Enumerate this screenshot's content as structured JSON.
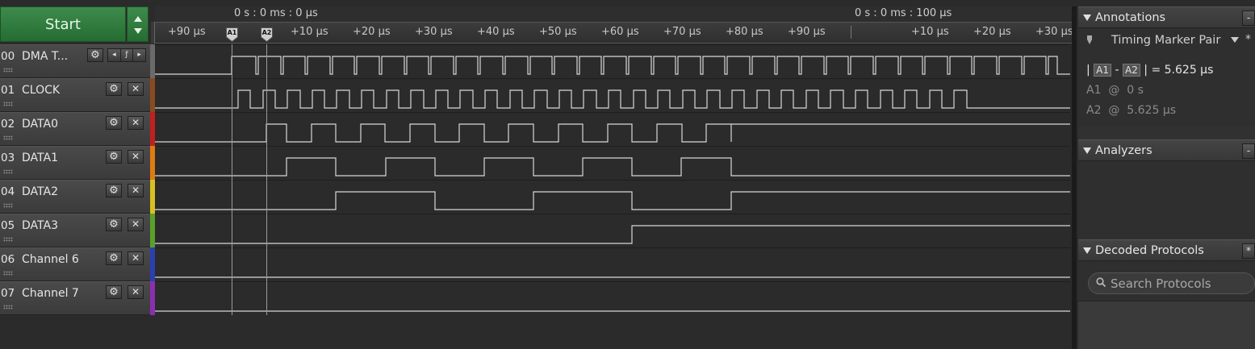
{
  "toolbar": {
    "start_label": "Start"
  },
  "timeline": {
    "absolute_times": [
      "0 s : 0 ms : 0 μs",
      "0 s : 0 ms : 100 μs"
    ],
    "ticks": [
      "+90 μs",
      "+10 μs",
      "+20 μs",
      "+30 μs",
      "+40 μs",
      "+50 μs",
      "+60 μs",
      "+70 μs",
      "+80 μs",
      "+90 μs",
      "+10 μs",
      "+20 μs",
      "+30 μs"
    ],
    "markers": [
      "A1",
      "A2"
    ]
  },
  "channels": [
    {
      "number": "00",
      "name": "DMA T...",
      "color": "#6a6a6a",
      "trigger_controls": [
        "◂",
        "ƒ",
        "▸"
      ]
    },
    {
      "number": "01",
      "name": "CLOCK",
      "color": "#8b4a1f"
    },
    {
      "number": "02",
      "name": "DATA0",
      "color": "#c21f1f"
    },
    {
      "number": "03",
      "name": "DATA1",
      "color": "#e07a12"
    },
    {
      "number": "04",
      "name": "DATA2",
      "color": "#d8c020"
    },
    {
      "number": "05",
      "name": "DATA3",
      "color": "#5aa02c"
    },
    {
      "number": "06",
      "name": "Channel 6",
      "color": "#2c3fb0"
    },
    {
      "number": "07",
      "name": "Channel 7",
      "color": "#8a2fb0"
    }
  ],
  "icons": {
    "gear": "⚙",
    "close": "✕",
    "pin": "📍",
    "dropdown": "▼",
    "search": "🔍",
    "edge_minus": "-",
    "edge_star": "*"
  },
  "annotations": {
    "title": "Annotations",
    "pair_label": "Timing Marker Pair",
    "delta": {
      "prefix": "|",
      "a": "A1",
      "sep": "-",
      "b": "A2",
      "suffix": "| =",
      "value": "5.625 μs"
    },
    "a1": {
      "label": "A1",
      "at": "@",
      "value": "0 s"
    },
    "a2": {
      "label": "A2",
      "at": "@",
      "value": "5.625 μs"
    }
  },
  "analyzers": {
    "title": "Analyzers"
  },
  "decoded": {
    "title": "Decoded Protocols",
    "search_placeholder": "Search Protocols"
  }
}
